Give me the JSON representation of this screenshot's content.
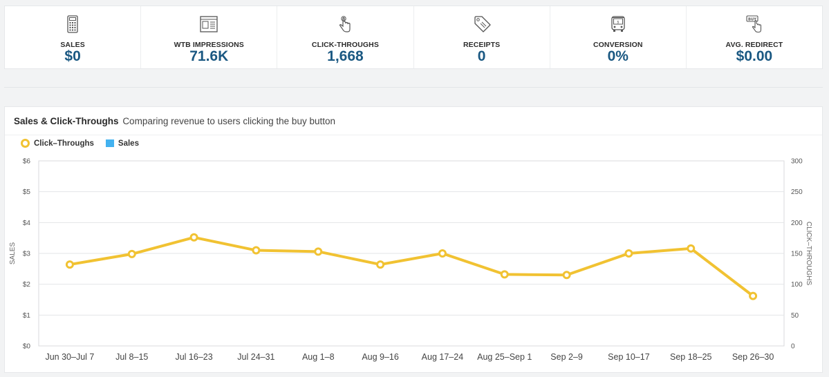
{
  "stats": [
    {
      "icon": "calculator-icon",
      "label": "SALES",
      "value": "$0"
    },
    {
      "icon": "newspaper-icon",
      "label": "WTB IMPRESSIONS",
      "value": "71.6K"
    },
    {
      "icon": "pointer-hand-icon",
      "label": "CLICK-THROUGHS",
      "value": "1,668"
    },
    {
      "icon": "receipt-tag-icon",
      "label": "RECEIPTS",
      "value": "0"
    },
    {
      "icon": "bus-icon",
      "label": "CONVERSION",
      "value": "0%"
    },
    {
      "icon": "buy-button-icon",
      "label": "AVG. REDIRECT",
      "value": "$0.00"
    }
  ],
  "panel": {
    "title": "Sales & Click-Throughs",
    "subtitle": "Comparing revenue to users clicking the buy button"
  },
  "legend": {
    "click_throughs": "Click–Throughs",
    "sales": "Sales"
  },
  "chart_data": {
    "type": "line",
    "categories": [
      "Jun 30–Jul 7",
      "Jul 8–15",
      "Jul 16–23",
      "Jul 24–31",
      "Aug 1–8",
      "Aug 9–16",
      "Aug 17–24",
      "Aug 25–Sep 1",
      "Sep 2–9",
      "Sep 10–17",
      "Sep 18–25",
      "Sep 26–30"
    ],
    "series": [
      {
        "name": "Click–Throughs",
        "axis": "right",
        "color": "#f1c232",
        "values": [
          132,
          149,
          176,
          155,
          153,
          132,
          150,
          116,
          115,
          150,
          158,
          81
        ]
      },
      {
        "name": "Sales",
        "axis": "left",
        "color": "#43b2f0",
        "values": [
          0,
          0,
          0,
          0,
          0,
          0,
          0,
          0,
          0,
          0,
          0,
          0
        ]
      }
    ],
    "ylabel": "SALES",
    "y2label": "CLICK–THROUGHS",
    "ylim": [
      0,
      6
    ],
    "y2lim": [
      0,
      300
    ],
    "yticks": [
      "$0",
      "$1",
      "$2",
      "$3",
      "$4",
      "$5",
      "$6"
    ],
    "y2ticks": [
      "0",
      "50",
      "100",
      "150",
      "200",
      "250",
      "300"
    ],
    "grid": true,
    "legend_position": "top-left"
  }
}
